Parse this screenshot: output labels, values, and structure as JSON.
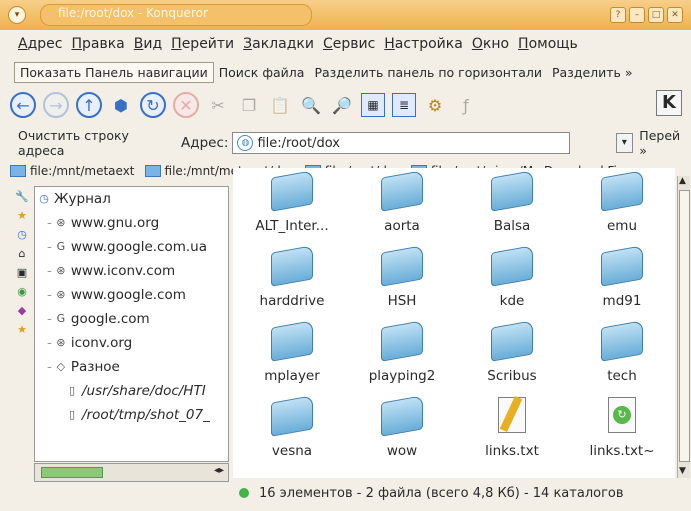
{
  "window": {
    "title": "file:/root/dox - Konqueror"
  },
  "menu": [
    "Адрес",
    "Правка",
    "Вид",
    "Перейти",
    "Закладки",
    "Сервис",
    "Настройка",
    "Окно",
    "Помощь"
  ],
  "linkbar": [
    "Показать Панель навигации",
    "Поиск файла",
    "Разделить панель по горизонтали",
    "Разделить »"
  ],
  "addressbar": {
    "clear_label": "Очистить строку адреса",
    "address_label": "Адрес:",
    "value": "file:/root/dox",
    "go_label": "Перей »"
  },
  "bookmarks": [
    "file:/mnt/metaext",
    "file:/mnt/metaext/dox",
    "file:/root/dox",
    "file:/mnt/win_c/My Download Fi »"
  ],
  "tree": [
    {
      "label": "Журнал",
      "icon": "history-icon"
    },
    {
      "label": "www.gnu.org",
      "icon": "link-icon"
    },
    {
      "label": "www.google.com.ua",
      "icon": "google-icon"
    },
    {
      "label": "www.iconv.com",
      "icon": "link-icon"
    },
    {
      "label": "www.google.com",
      "icon": "link-icon"
    },
    {
      "label": "google.com",
      "icon": "google-icon"
    },
    {
      "label": "iconv.org",
      "icon": "link-icon"
    },
    {
      "label": "Разное",
      "icon": "folder-icon"
    },
    {
      "label": "/usr/share/doc/HTI",
      "icon": "file-icon"
    },
    {
      "label": "/root/tmp/shot_07_",
      "icon": "file-icon"
    }
  ],
  "files": [
    {
      "name": "ALT_Inter...",
      "type": "folder"
    },
    {
      "name": "aorta",
      "type": "folder"
    },
    {
      "name": "Balsa",
      "type": "folder"
    },
    {
      "name": "emu",
      "type": "folder"
    },
    {
      "name": "harddrive",
      "type": "folder"
    },
    {
      "name": "HSH",
      "type": "folder"
    },
    {
      "name": "kde",
      "type": "folder"
    },
    {
      "name": "md91",
      "type": "folder"
    },
    {
      "name": "mplayer",
      "type": "folder"
    },
    {
      "name": "playping2",
      "type": "folder"
    },
    {
      "name": "Scribus",
      "type": "folder"
    },
    {
      "name": "tech",
      "type": "folder"
    },
    {
      "name": "vesna",
      "type": "folder"
    },
    {
      "name": "wow",
      "type": "folder"
    },
    {
      "name": "links.txt",
      "type": "text"
    },
    {
      "name": "links.txt~",
      "type": "link"
    }
  ],
  "status": "16 элементов - 2 файла (всего 4,8 Кб) - 14 каталогов"
}
